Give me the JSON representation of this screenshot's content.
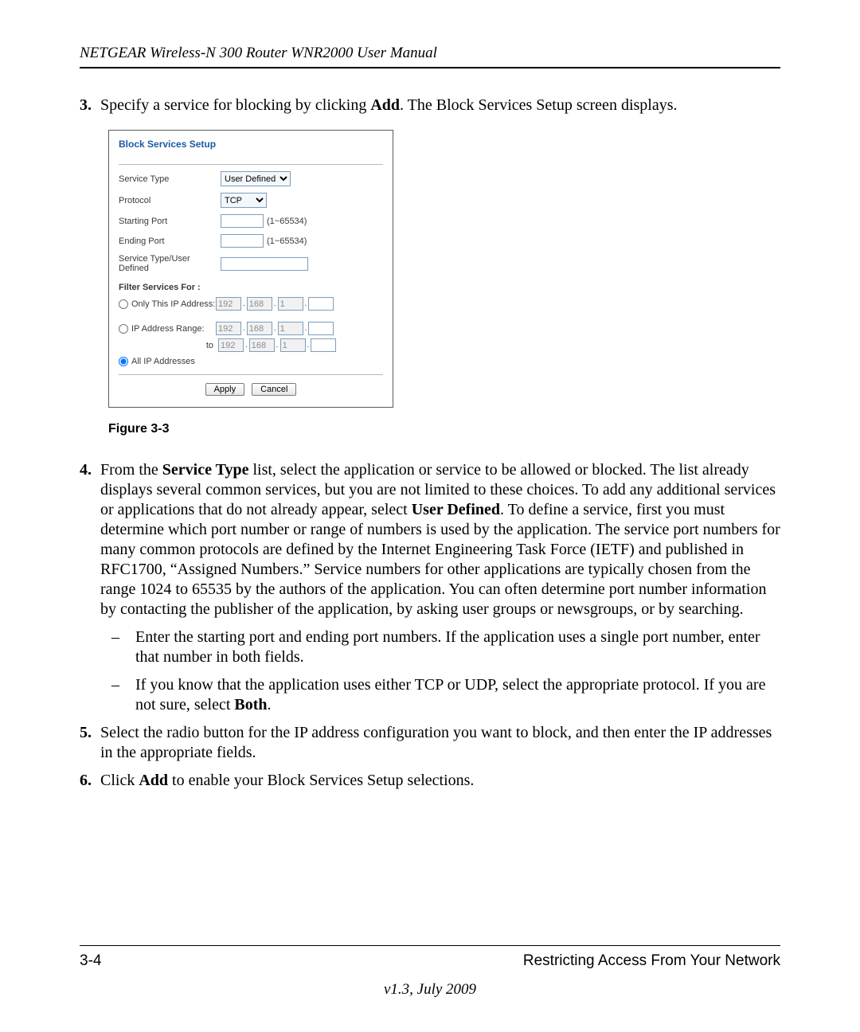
{
  "header": "NETGEAR Wireless-N 300 Router WNR2000 User Manual",
  "steps": {
    "s3": {
      "num": "3.",
      "text_a": "Specify a service for blocking by clicking ",
      "bold_a": "Add",
      "text_b": ". The Block Services Setup screen displays."
    },
    "s4": {
      "num": "4.",
      "text_a": "From the ",
      "bold_a": "Service Type",
      "text_b": " list, select the application or service to be allowed or blocked. The list already displays several common services, but you are not limited to these choices. To add any additional services or applications that do not already appear, select ",
      "bold_b": "User Defined",
      "text_c": ". To define a service, first you must determine which port number or range of numbers is used by the application. The service port numbers for many common protocols are defined by the Internet Engineering Task Force (IETF) and published in RFC1700, “Assigned Numbers.” Service numbers for other applications are typically chosen from the range 1024 to 65535 by the authors of the application. You can often determine port number information by contacting the publisher of the application, by asking user groups or newsgroups, or by searching.",
      "sub1": "Enter the starting port and ending port numbers. If the application uses a single port number, enter that number in both fields.",
      "sub2_a": "If you know that the application uses either TCP or UDP, select the appropriate protocol. If you are not sure, select ",
      "sub2_bold": "Both",
      "sub2_b": "."
    },
    "s5": {
      "num": "5.",
      "text": "Select the radio button for the IP address configuration you want to block, and then enter the IP addresses in the appropriate fields."
    },
    "s6": {
      "num": "6.",
      "text_a": "Click ",
      "bold_a": "Add",
      "text_b": " to enable your Block Services Setup selections."
    }
  },
  "figure": {
    "caption": "Figure 3-3",
    "panel_title": "Block Services Setup",
    "labels": {
      "service_type": "Service Type",
      "protocol": "Protocol",
      "starting_port": "Starting Port",
      "ending_port": "Ending Port",
      "user_defined": "Service Type/User Defined",
      "filter_for": "Filter Services For :",
      "only_ip": "Only This IP Address:",
      "ip_range": "IP Address Range:",
      "to": "to",
      "all_ip": "All IP Addresses"
    },
    "values": {
      "service_type_select": "User Defined",
      "protocol_select": "TCP",
      "port_range_hint": "(1~65534)",
      "ip_a": "192",
      "ip_b": "168",
      "ip_c": "1",
      "ip_d": "",
      "apply": "Apply",
      "cancel": "Cancel"
    }
  },
  "footer": {
    "left": "3-4",
    "right": "Restricting Access From Your Network",
    "version": "v1.3, July 2009"
  }
}
